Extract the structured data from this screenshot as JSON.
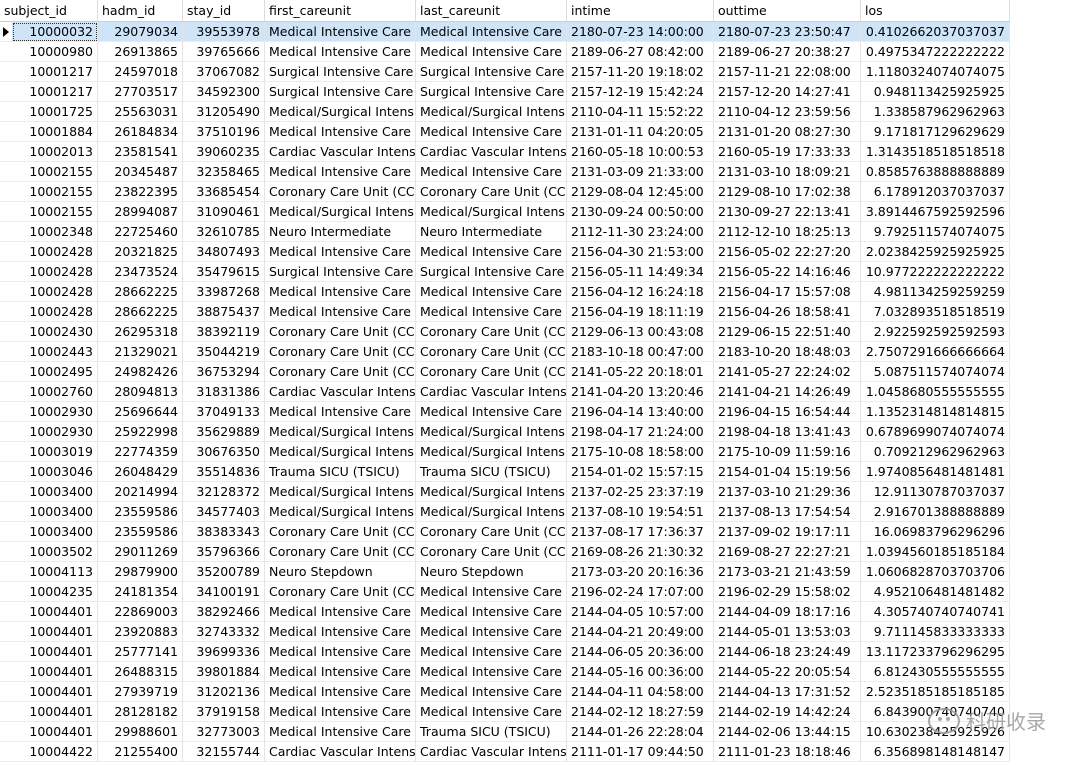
{
  "columns": [
    "subject_id",
    "hadm_id",
    "stay_id",
    "first_careunit",
    "last_careunit",
    "intime",
    "outtime",
    "los"
  ],
  "rows": [
    [
      "10000032",
      "29079034",
      "39553978",
      "Medical Intensive Care U",
      "Medical Intensive Care U",
      "2180-07-23 14:00:00",
      "2180-07-23 23:50:47",
      "0.4102662037037037"
    ],
    [
      "10000980",
      "26913865",
      "39765666",
      "Medical Intensive Care U",
      "Medical Intensive Care U",
      "2189-06-27 08:42:00",
      "2189-06-27 20:38:27",
      "0.4975347222222222"
    ],
    [
      "10001217",
      "24597018",
      "37067082",
      "Surgical Intensive Care U",
      "Surgical Intensive Care U",
      "2157-11-20 19:18:02",
      "2157-11-21 22:08:00",
      "1.1180324074074075"
    ],
    [
      "10001217",
      "27703517",
      "34592300",
      "Surgical Intensive Care U",
      "Surgical Intensive Care U",
      "2157-12-19 15:42:24",
      "2157-12-20 14:27:41",
      "0.948113425925925"
    ],
    [
      "10001725",
      "25563031",
      "31205490",
      "Medical/Surgical Intensiv",
      "Medical/Surgical Intensiv",
      "2110-04-11 15:52:22",
      "2110-04-12 23:59:56",
      "1.338587962962963"
    ],
    [
      "10001884",
      "26184834",
      "37510196",
      "Medical Intensive Care U",
      "Medical Intensive Care U",
      "2131-01-11 04:20:05",
      "2131-01-20 08:27:30",
      "9.171817129629629"
    ],
    [
      "10002013",
      "23581541",
      "39060235",
      "Cardiac Vascular Intensiv",
      "Cardiac Vascular Intensiv",
      "2160-05-18 10:00:53",
      "2160-05-19 17:33:33",
      "1.3143518518518518"
    ],
    [
      "10002155",
      "20345487",
      "32358465",
      "Medical Intensive Care U",
      "Medical Intensive Care U",
      "2131-03-09 21:33:00",
      "2131-03-10 18:09:21",
      "0.8585763888888889"
    ],
    [
      "10002155",
      "23822395",
      "33685454",
      "Coronary Care Unit (CCU",
      "Coronary Care Unit (CCU",
      "2129-08-04 12:45:00",
      "2129-08-10 17:02:38",
      "6.178912037037037"
    ],
    [
      "10002155",
      "28994087",
      "31090461",
      "Medical/Surgical Intensiv",
      "Medical/Surgical Intensiv",
      "2130-09-24 00:50:00",
      "2130-09-27 22:13:41",
      "3.8914467592592596"
    ],
    [
      "10002348",
      "22725460",
      "32610785",
      "Neuro Intermediate",
      "Neuro Intermediate",
      "2112-11-30 23:24:00",
      "2112-12-10 18:25:13",
      "9.792511574074075"
    ],
    [
      "10002428",
      "20321825",
      "34807493",
      "Medical Intensive Care U",
      "Medical Intensive Care U",
      "2156-04-30 21:53:00",
      "2156-05-02 22:27:20",
      "2.0238425925925925"
    ],
    [
      "10002428",
      "23473524",
      "35479615",
      "Surgical Intensive Care U",
      "Surgical Intensive Care U",
      "2156-05-11 14:49:34",
      "2156-05-22 14:16:46",
      "10.977222222222222"
    ],
    [
      "10002428",
      "28662225",
      "33987268",
      "Medical Intensive Care U",
      "Medical Intensive Care U",
      "2156-04-12 16:24:18",
      "2156-04-17 15:57:08",
      "4.981134259259259"
    ],
    [
      "10002428",
      "28662225",
      "38875437",
      "Medical Intensive Care U",
      "Medical Intensive Care U",
      "2156-04-19 18:11:19",
      "2156-04-26 18:58:41",
      "7.032893518518519"
    ],
    [
      "10002430",
      "26295318",
      "38392119",
      "Coronary Care Unit (CCU",
      "Coronary Care Unit (CCU",
      "2129-06-13 00:43:08",
      "2129-06-15 22:51:40",
      "2.922592592592593"
    ],
    [
      "10002443",
      "21329021",
      "35044219",
      "Coronary Care Unit (CCU",
      "Coronary Care Unit (CCU",
      "2183-10-18 00:47:00",
      "2183-10-20 18:48:03",
      "2.7507291666666664"
    ],
    [
      "10002495",
      "24982426",
      "36753294",
      "Coronary Care Unit (CCU",
      "Coronary Care Unit (CCU",
      "2141-05-22 20:18:01",
      "2141-05-27 22:24:02",
      "5.087511574074074"
    ],
    [
      "10002760",
      "28094813",
      "31831386",
      "Cardiac Vascular Intensiv",
      "Cardiac Vascular Intensiv",
      "2141-04-20 13:20:46",
      "2141-04-21 14:26:49",
      "1.0458680555555555"
    ],
    [
      "10002930",
      "25696644",
      "37049133",
      "Medical Intensive Care U",
      "Medical Intensive Care U",
      "2196-04-14 13:40:00",
      "2196-04-15 16:54:44",
      "1.1352314814814815"
    ],
    [
      "10002930",
      "25922998",
      "35629889",
      "Medical/Surgical Intensiv",
      "Medical/Surgical Intensiv",
      "2198-04-17 21:24:00",
      "2198-04-18 13:41:43",
      "0.6789699074074074"
    ],
    [
      "10003019",
      "22774359",
      "30676350",
      "Medical/Surgical Intensiv",
      "Medical/Surgical Intensiv",
      "2175-10-08 18:58:00",
      "2175-10-09 11:59:16",
      "0.709212962962963"
    ],
    [
      "10003046",
      "26048429",
      "35514836",
      "Trauma SICU (TSICU)",
      "Trauma SICU (TSICU)",
      "2154-01-02 15:57:15",
      "2154-01-04 15:19:56",
      "1.9740856481481481"
    ],
    [
      "10003400",
      "20214994",
      "32128372",
      "Medical/Surgical Intensiv",
      "Medical/Surgical Intensiv",
      "2137-02-25 23:37:19",
      "2137-03-10 21:29:36",
      "12.91130787037037"
    ],
    [
      "10003400",
      "23559586",
      "34577403",
      "Medical/Surgical Intensiv",
      "Medical/Surgical Intensiv",
      "2137-08-10 19:54:51",
      "2137-08-13 17:54:54",
      "2.916701388888889"
    ],
    [
      "10003400",
      "23559586",
      "38383343",
      "Coronary Care Unit (CCU",
      "Coronary Care Unit (CCU",
      "2137-08-17 17:36:37",
      "2137-09-02 19:17:11",
      "16.06983796296296"
    ],
    [
      "10003502",
      "29011269",
      "35796366",
      "Coronary Care Unit (CCU",
      "Coronary Care Unit (CCU",
      "2169-08-26 21:30:32",
      "2169-08-27 22:27:21",
      "1.0394560185185184"
    ],
    [
      "10004113",
      "29879900",
      "35200789",
      "Neuro Stepdown",
      "Neuro Stepdown",
      "2173-03-20 20:16:36",
      "2173-03-21 21:43:59",
      "1.0606828703703706"
    ],
    [
      "10004235",
      "24181354",
      "34100191",
      "Coronary Care Unit (CCU",
      "Medical Intensive Care U",
      "2196-02-24 17:07:00",
      "2196-02-29 15:58:02",
      "4.952106481481482"
    ],
    [
      "10004401",
      "22869003",
      "38292466",
      "Medical Intensive Care U",
      "Medical Intensive Care U",
      "2144-04-05 10:57:00",
      "2144-04-09 18:17:16",
      "4.305740740740741"
    ],
    [
      "10004401",
      "23920883",
      "32743332",
      "Medical Intensive Care U",
      "Medical Intensive Care U",
      "2144-04-21 20:49:00",
      "2144-05-01 13:53:03",
      "9.711145833333333"
    ],
    [
      "10004401",
      "25777141",
      "39699336",
      "Medical Intensive Care U",
      "Medical Intensive Care U",
      "2144-06-05 20:36:00",
      "2144-06-18 23:24:49",
      "13.117233796296295"
    ],
    [
      "10004401",
      "26488315",
      "39801884",
      "Medical Intensive Care U",
      "Medical Intensive Care U",
      "2144-05-16 00:36:00",
      "2144-05-22 20:05:54",
      "6.812430555555555"
    ],
    [
      "10004401",
      "27939719",
      "31202136",
      "Medical Intensive Care U",
      "Medical Intensive Care U",
      "2144-04-11 04:58:00",
      "2144-04-13 17:31:52",
      "2.5235185185185185"
    ],
    [
      "10004401",
      "28128182",
      "37919158",
      "Medical Intensive Care U",
      "Medical Intensive Care U",
      "2144-02-12 18:27:59",
      "2144-02-19 14:42:24",
      "6.843900740740740"
    ],
    [
      "10004401",
      "29988601",
      "32773003",
      "Medical Intensive Care U",
      "Trauma SICU (TSICU)",
      "2144-01-26 22:28:04",
      "2144-02-06 13:44:15",
      "10.630238425925926"
    ],
    [
      "10004422",
      "21255400",
      "32155744",
      "Cardiac Vascular Intensiv",
      "Cardiac Vascular Intensiv",
      "2111-01-17 09:44:50",
      "2111-01-23 18:18:46",
      "6.356898148148147"
    ]
  ],
  "selected_row": 0,
  "watermark": {
    "text": "科研收录",
    "icon": "wechat-icon"
  }
}
